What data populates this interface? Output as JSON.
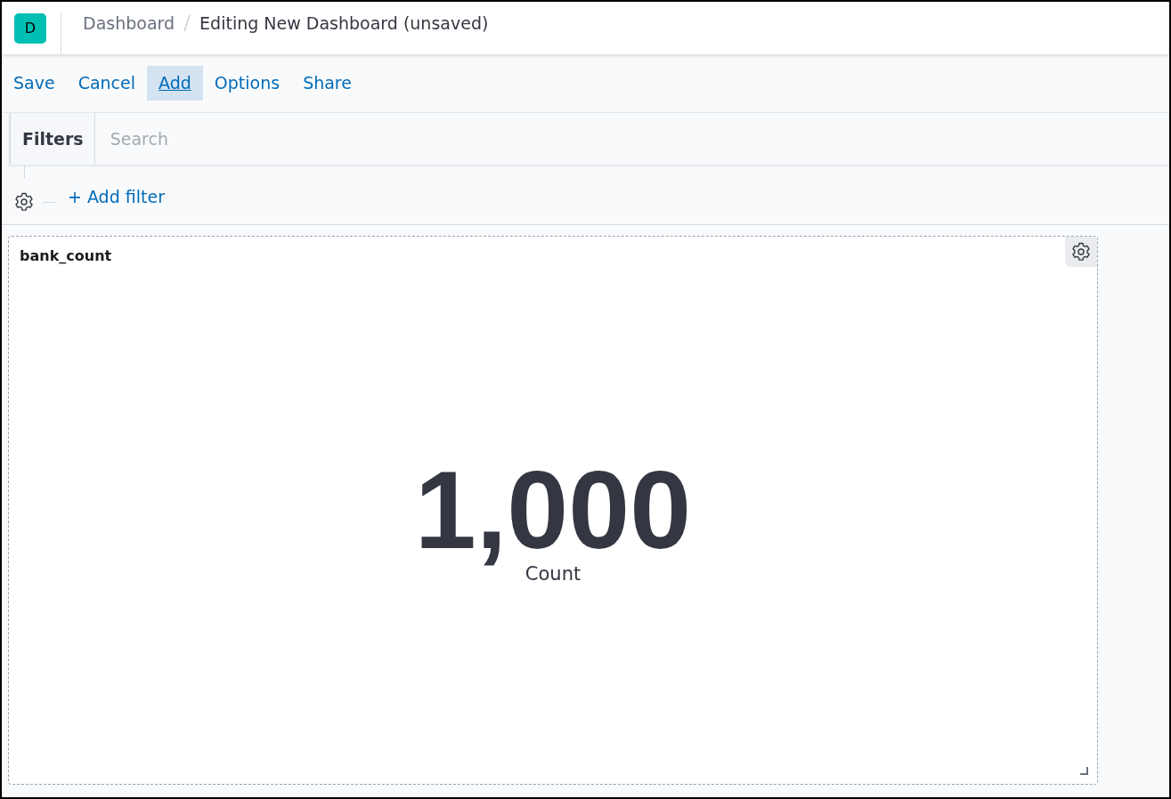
{
  "header": {
    "logo_letter": "D",
    "breadcrumbs": [
      {
        "label": "Dashboard",
        "current": false
      },
      {
        "label": "Editing New Dashboard (unsaved)",
        "current": true
      }
    ]
  },
  "menu": [
    {
      "label": "Save",
      "selected": false
    },
    {
      "label": "Cancel",
      "selected": false
    },
    {
      "label": "Add",
      "selected": true
    },
    {
      "label": "Options",
      "selected": false
    },
    {
      "label": "Share",
      "selected": false
    }
  ],
  "query_bar": {
    "filters_label": "Filters",
    "search": {
      "placeholder": "Search"
    }
  },
  "filter_actions": {
    "add_filter": "+ Add filter"
  },
  "panels": [
    {
      "title": "bank_count",
      "metric": {
        "value": "1,000",
        "label": "Count"
      }
    }
  ]
}
